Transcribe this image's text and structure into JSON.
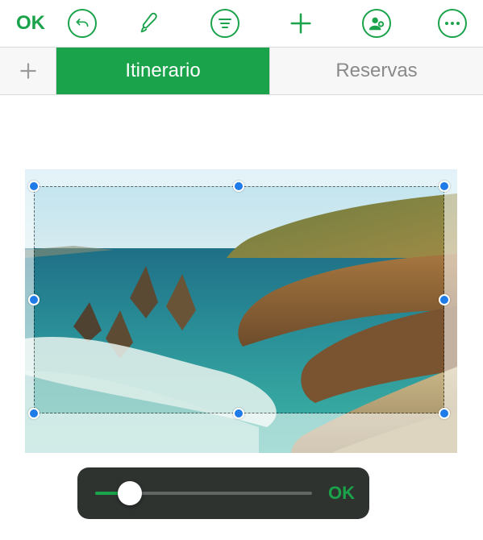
{
  "toolbar": {
    "ok_label": "OK"
  },
  "tabs": {
    "items": [
      {
        "label": "Itinerario",
        "active": true
      },
      {
        "label": "Reservas",
        "active": false
      }
    ]
  },
  "mask_slider": {
    "ok_label": "OK",
    "percent": 16
  },
  "selection": {
    "inner_left_pct": 2,
    "inner_top_pct": 6,
    "inner_right_pct": 97,
    "inner_bottom_pct": 86
  },
  "colors": {
    "accent": "#1aa34a",
    "handle": "#1f7be8",
    "slider_bg": "#2f3330"
  }
}
